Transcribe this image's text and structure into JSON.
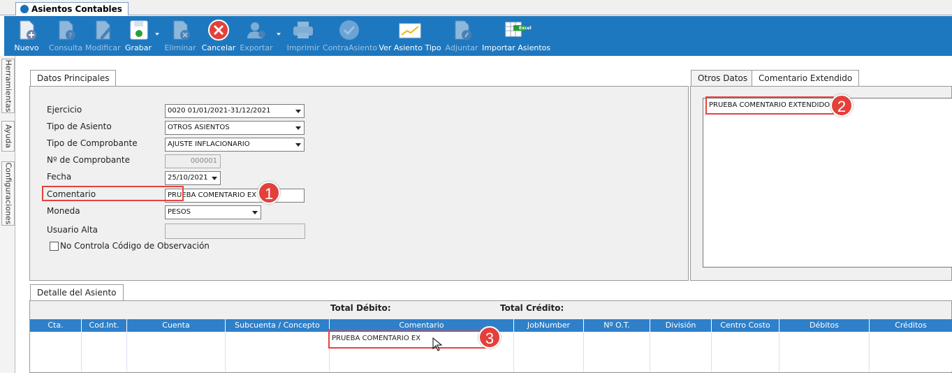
{
  "window": {
    "tab_title": "Asientos Contables"
  },
  "toolbar": {
    "buttons": [
      {
        "label": "Nuevo"
      },
      {
        "label": "Consulta"
      },
      {
        "label": "Modificar"
      },
      {
        "label": "Grabar"
      },
      {
        "label": "Eliminar"
      },
      {
        "label": "Cancelar"
      },
      {
        "label": "Exportar"
      },
      {
        "label": "Imprimir"
      },
      {
        "label": "ContraAsiento"
      },
      {
        "label": "Ver Asiento Tipo"
      },
      {
        "label": "Adjuntar"
      },
      {
        "label": "Importar Asientos"
      }
    ],
    "excel_badge": "Excel"
  },
  "side_tabs": [
    "Herramientas",
    "Ayuda",
    "Configuraciones"
  ],
  "datos_principales": {
    "tab": "Datos Principales",
    "fields": {
      "ejercicio": {
        "label": "Ejercicio",
        "value": "0020 01/01/2021-31/12/2021"
      },
      "tipo_asiento": {
        "label": "Tipo de Asiento",
        "value": "OTROS ASIENTOS"
      },
      "tipo_comprobante": {
        "label": "Tipo de Comprobante",
        "value": "AJUSTE INFLACIONARIO"
      },
      "nro_comprobante": {
        "label": "Nº de Comprobante",
        "value": "000001"
      },
      "fecha": {
        "label": "Fecha",
        "value": "25/10/2021"
      },
      "comentario": {
        "label": "Comentario",
        "value": "PRUEBA COMENTARIO EX"
      },
      "moneda": {
        "label": "Moneda",
        "value": "PESOS"
      },
      "usuario_alta": {
        "label": "Usuario Alta",
        "value": ""
      },
      "no_controla": {
        "label": "No Controla Código de Observación"
      }
    }
  },
  "right_panel": {
    "tabs": [
      "Otros Datos",
      "Comentario Extendido"
    ],
    "comentario_extendido": "PRUEBA COMENTARIO EXTENDIDO"
  },
  "detalle": {
    "tab": "Detalle del Asiento",
    "total_debito": "Total Débito:",
    "total_credito": "Total Crédito:",
    "columns": [
      "Cta.",
      "Cod.Int.",
      "Cuenta",
      "Subcuenta / Concepto",
      "Comentario",
      "JobNumber",
      "Nº O.T.",
      "División",
      "Centro Costo",
      "Débitos",
      "Créditos"
    ],
    "row1_comentario": "PRUEBA COMENTARIO EX"
  },
  "annotations": [
    "1",
    "2",
    "3"
  ],
  "colors": {
    "toolbar": "#1e78bf",
    "grid_header": "#2f80c9",
    "highlight": "#e5433f"
  }
}
